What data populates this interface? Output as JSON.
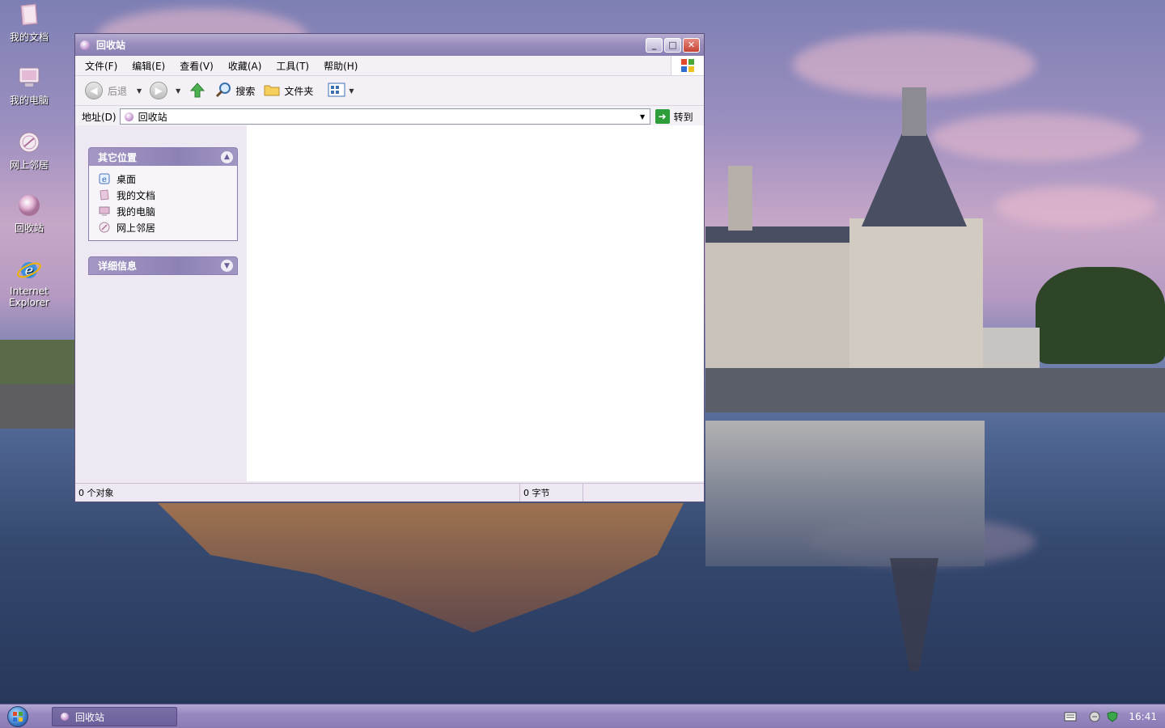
{
  "desktop": {
    "icons": [
      {
        "label": "我的文档",
        "icon": "my-documents-icon"
      },
      {
        "label": "我的电脑",
        "icon": "my-computer-icon"
      },
      {
        "label": "网上邻居",
        "icon": "network-places-icon"
      },
      {
        "label": "回收站",
        "icon": "recycle-bin-icon"
      },
      {
        "label": "Internet Explorer",
        "icon": "internet-explorer-icon"
      }
    ]
  },
  "window": {
    "title": "回收站",
    "menu": [
      "文件(F)",
      "编辑(E)",
      "查看(V)",
      "收藏(A)",
      "工具(T)",
      "帮助(H)"
    ],
    "toolbar": {
      "back": "后退",
      "search": "搜索",
      "folders": "文件夹"
    },
    "address": {
      "label": "地址(D)",
      "value": "回收站",
      "go": "转到"
    },
    "sidebar": {
      "other_places": {
        "title": "其它位置",
        "items": [
          "桌面",
          "我的文档",
          "我的电脑",
          "网上邻居"
        ]
      },
      "details": {
        "title": "详细信息"
      }
    },
    "status": {
      "objects": "0 个对象",
      "size": "0 字节"
    }
  },
  "taskbar": {
    "active_task": "回收站",
    "clock": "16:41"
  },
  "colors": {
    "accent": "#8a7db2",
    "window_bg": "#ede8f1",
    "go_green": "#2e9e3b"
  }
}
